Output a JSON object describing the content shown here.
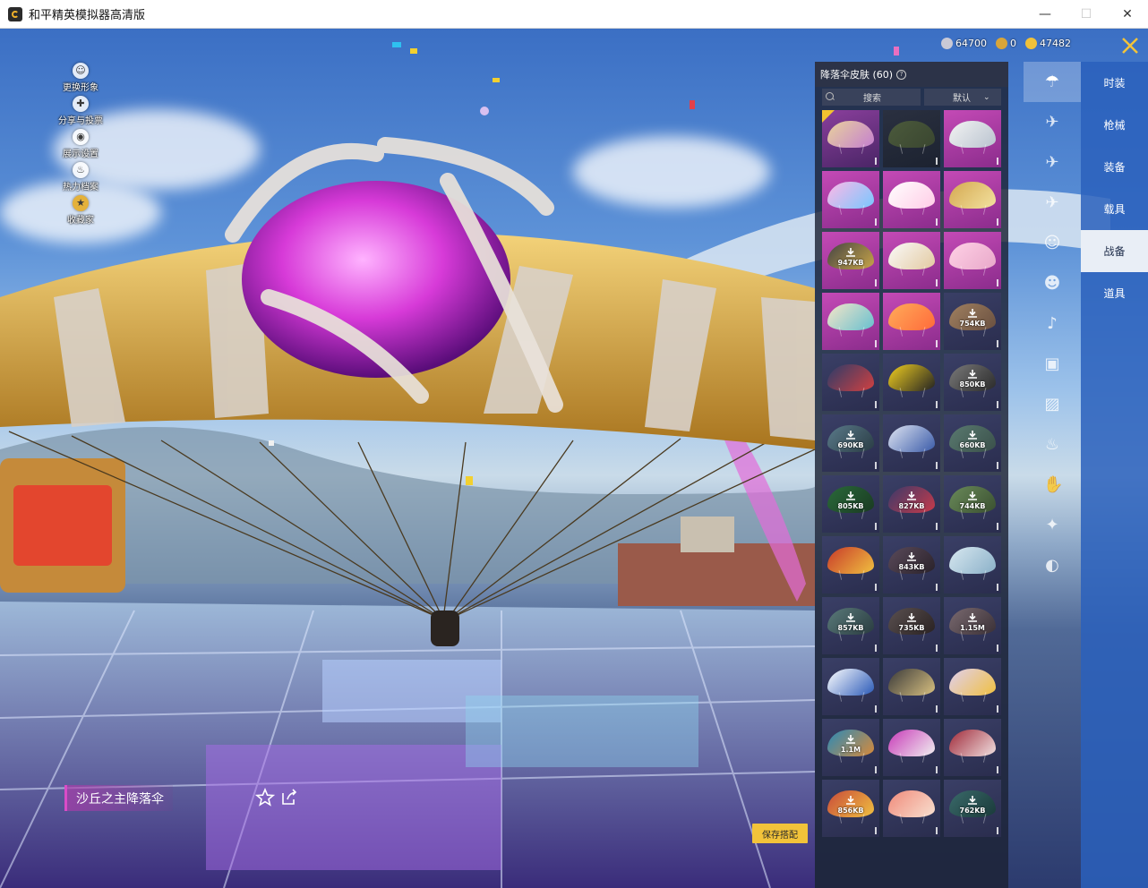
{
  "window": {
    "title": "和平精英模拟器高清版",
    "minimize": "—",
    "maximize": "☐",
    "close": "✕"
  },
  "left_menu": [
    {
      "label": "更换形象",
      "icon": "avatar-icon"
    },
    {
      "label": "分享与投票",
      "icon": "share-icon"
    },
    {
      "label": "展示设置",
      "icon": "eye-icon"
    },
    {
      "label": "热力档案",
      "icon": "flame-icon"
    },
    {
      "label": "收藏家",
      "icon": "collector-icon"
    }
  ],
  "currency": [
    {
      "value": "64700",
      "icon": "coin-silver-icon",
      "color": "#c9c9d6"
    },
    {
      "value": "0",
      "icon": "coin-gold-icon",
      "color": "#d8a53a"
    },
    {
      "value": "47482",
      "icon": "coupon-icon",
      "color": "#f0c13a"
    }
  ],
  "panel": {
    "title": "降落伞皮肤 (60)",
    "search_label": "搜索",
    "sort_label": "默认"
  },
  "skins": [
    {
      "style": "purple",
      "selected": true,
      "colors": [
        "#e9d29b",
        "#c47fd0"
      ],
      "label": ""
    },
    {
      "style": "dark",
      "colors": [
        "#4b5a3c",
        "#3a4630"
      ],
      "label": ""
    },
    {
      "style": "purple",
      "colors": [
        "#f3f3f3",
        "#b9c3cf"
      ],
      "label": ""
    },
    {
      "style": "purple",
      "colors": [
        "#ffb8e6",
        "#77c7ff"
      ],
      "label": ""
    },
    {
      "style": "purple",
      "colors": [
        "#ffffff",
        "#ffcce6"
      ],
      "label": ""
    },
    {
      "style": "purple",
      "colors": [
        "#d4a850",
        "#f3e2a0"
      ],
      "label": ""
    },
    {
      "style": "purple",
      "colors": [
        "#444",
        "#c9a548"
      ],
      "label": "947KB"
    },
    {
      "style": "purple",
      "colors": [
        "#fafafa",
        "#e3c9a0"
      ],
      "label": ""
    },
    {
      "style": "purple",
      "colors": [
        "#ffd1e6",
        "#e8a8c9"
      ],
      "label": ""
    },
    {
      "style": "purple",
      "colors": [
        "#f7e6c8",
        "#66bfcf"
      ],
      "label": ""
    },
    {
      "style": "purple",
      "colors": [
        "#ffac5a",
        "#ff6a3a"
      ],
      "label": ""
    },
    {
      "style": "default",
      "colors": [
        "#a08060",
        "#6a5040"
      ],
      "label": "754KB"
    },
    {
      "style": "default",
      "colors": [
        "#2a3c6a",
        "#d24040"
      ],
      "label": ""
    },
    {
      "style": "default",
      "colors": [
        "#f2d020",
        "#222"
      ],
      "label": ""
    },
    {
      "style": "default",
      "colors": [
        "#7a7a7a",
        "#2a2a2a"
      ],
      "label": "850KB"
    },
    {
      "style": "default",
      "colors": [
        "#5a7a8a",
        "#2a3c44"
      ],
      "label": "690KB"
    },
    {
      "style": "default",
      "colors": [
        "#dfe5f2",
        "#3a5aa8"
      ],
      "label": ""
    },
    {
      "style": "default",
      "colors": [
        "#5a7a70",
        "#3a504a"
      ],
      "label": "660KB"
    },
    {
      "style": "default",
      "colors": [
        "#2a6a3a",
        "#1a3a22"
      ],
      "label": "805KB"
    },
    {
      "style": "default",
      "colors": [
        "#3a3a6a",
        "#c83a4a"
      ],
      "label": "827KB"
    },
    {
      "style": "default",
      "colors": [
        "#6a8a5a",
        "#3a5030"
      ],
      "label": "744KB"
    },
    {
      "style": "default",
      "colors": [
        "#c83a2a",
        "#f0c040"
      ],
      "label": ""
    },
    {
      "style": "default",
      "colors": [
        "#5a4a5a",
        "#2a222a"
      ],
      "label": "843KB"
    },
    {
      "style": "default",
      "colors": [
        "#d8e8f0",
        "#8ab0c8"
      ],
      "label": ""
    },
    {
      "style": "default",
      "colors": [
        "#5a7a7a",
        "#2a3c40"
      ],
      "label": "857KB"
    },
    {
      "style": "default",
      "colors": [
        "#5a5050",
        "#2a2222"
      ],
      "label": "735KB"
    },
    {
      "style": "default",
      "colors": [
        "#7a6a70",
        "#3a3036"
      ],
      "label": "1.15M"
    },
    {
      "style": "default",
      "colors": [
        "#ffffff",
        "#2a5ab8"
      ],
      "label": ""
    },
    {
      "style": "default",
      "colors": [
        "#3a3a3a",
        "#d8c080"
      ],
      "label": ""
    },
    {
      "style": "default",
      "colors": [
        "#e0d0f0",
        "#f0c040"
      ],
      "label": ""
    },
    {
      "style": "default",
      "colors": [
        "#2a8ab8",
        "#d88a3a"
      ],
      "label": "1.1M"
    },
    {
      "style": "default",
      "colors": [
        "#c83ab8",
        "#f0f0f0"
      ],
      "label": ""
    },
    {
      "style": "default",
      "colors": [
        "#a02a3a",
        "#f0e0e0"
      ],
      "label": ""
    },
    {
      "style": "default",
      "colors": [
        "#c84a3a",
        "#f0c040"
      ],
      "label": "856KB"
    },
    {
      "style": "default",
      "colors": [
        "#f08a7a",
        "#f8e0d0"
      ],
      "label": ""
    },
    {
      "style": "default",
      "colors": [
        "#3a6a6a",
        "#1a3a3a"
      ],
      "label": "762KB"
    }
  ],
  "rail_icons": [
    "parachute-icon",
    "glider-icon",
    "plane-icon",
    "jet-icon",
    "emote-icon",
    "robot-icon",
    "speaker-icon",
    "ticket-icon",
    "photo-icon",
    "extinguisher-icon",
    "hand-icon",
    "wand-icon",
    "planet-icon"
  ],
  "categories": [
    "时装",
    "枪械",
    "装备",
    "载具",
    "战备",
    "道具"
  ],
  "active_category": "战备",
  "selected_item_name": "沙丘之主降落伞",
  "save_button": "保存搭配"
}
